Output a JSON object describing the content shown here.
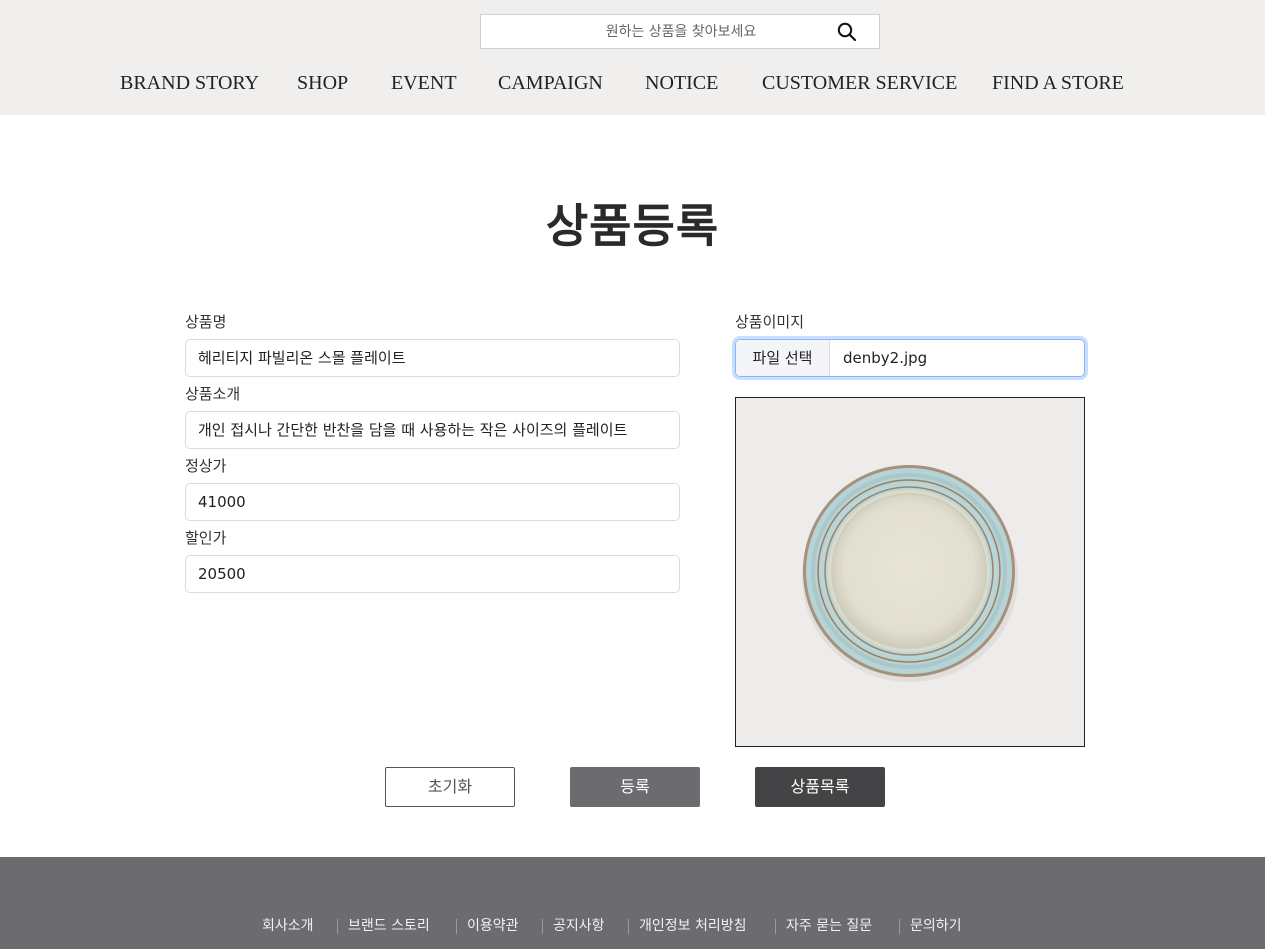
{
  "header": {
    "search": {
      "placeholder": "원하는 상품을 찾아보세요",
      "icon": "search-icon"
    },
    "nav": [
      "BRAND STORY",
      "SHOP",
      "EVENT",
      "CAMPAIGN",
      "NOTICE",
      "CUSTOMER SERVICE",
      "FIND A STORE"
    ]
  },
  "main": {
    "title": "상품등록",
    "fields": {
      "name": {
        "label": "상품명",
        "value": "헤리티지 파빌리온 스몰 플레이트"
      },
      "intro": {
        "label": "상품소개",
        "value": "개인 접시나 간단한 반찬을 담을 때 사용하는 작은 사이즈의 플레이트"
      },
      "price": {
        "label": "정상가",
        "value": "41000"
      },
      "sale_price": {
        "label": "할인가",
        "value": "20500"
      }
    },
    "image": {
      "label": "상품이미지",
      "file_button": "파일 선택",
      "file_name": "denby2.jpg"
    },
    "buttons": {
      "reset": "초기화",
      "submit": "등록",
      "list": "상품목록"
    }
  },
  "footer": {
    "links": [
      "회사소개",
      "브랜드 스토리",
      "이용약관",
      "공지사항",
      "개인정보 처리방침",
      "자주 묻는 질문",
      "문의하기"
    ]
  },
  "colors": {
    "header_bg": "#f0efed",
    "footer_bg": "#6b6b70",
    "submit_bg": "#6c6c70",
    "list_bg": "#444446",
    "focus_border": "#86b7fe"
  }
}
